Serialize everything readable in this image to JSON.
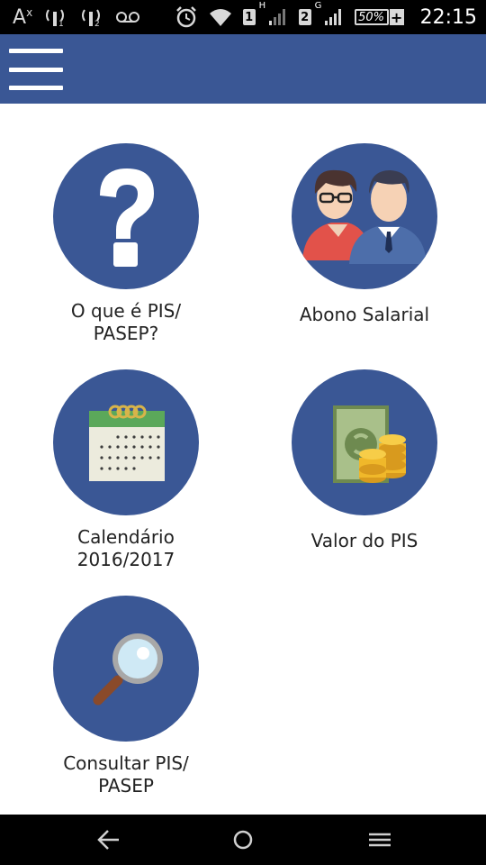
{
  "status_bar": {
    "font_indicator": "A",
    "sim1": "1",
    "network1": "H",
    "sim2": "2",
    "network2": "G",
    "battery_percent": "50%",
    "time": "22:15",
    "icons": [
      "font-size-icon",
      "signal-sim1-icon",
      "signal-sim2-icon",
      "voicemail-icon",
      "alarm-icon",
      "wifi-icon",
      "cell-signal-icon",
      "battery-icon"
    ]
  },
  "app_bar": {
    "menu_icon": "hamburger-menu-icon",
    "color": "#3a5795"
  },
  "tiles": [
    {
      "line1": "O que é PIS/",
      "line2": "PASEP?",
      "icon": "question-mark-icon"
    },
    {
      "line1": "Abono Salarial",
      "line2": "",
      "icon": "people-icon"
    },
    {
      "line1": "Calendário",
      "line2": "2016/2017",
      "icon": "calendar-icon"
    },
    {
      "line1": "Valor do PIS",
      "line2": "",
      "icon": "money-coins-icon"
    },
    {
      "line1": "Consultar PIS/",
      "line2": "PASEP",
      "icon": "magnifier-icon"
    }
  ],
  "nav_bar": {
    "buttons": [
      "back-icon",
      "home-icon",
      "recent-apps-icon"
    ]
  }
}
